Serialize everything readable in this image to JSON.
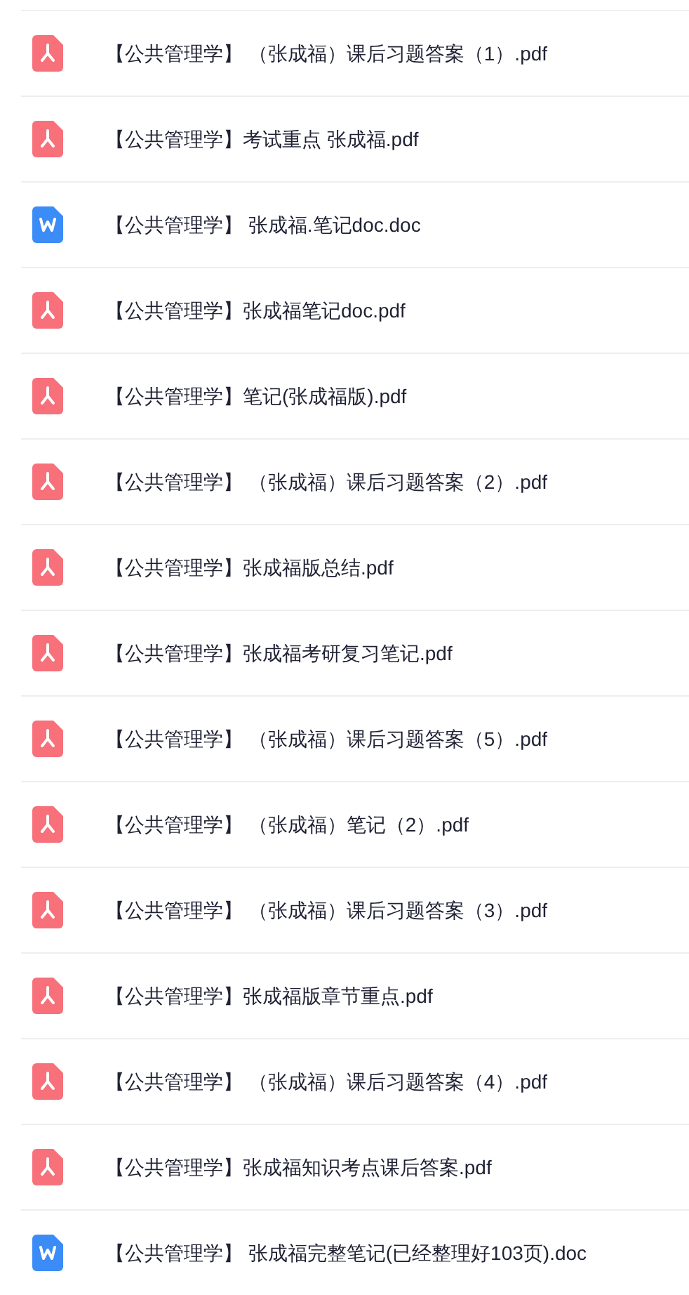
{
  "files": [
    {
      "kind": "pdf",
      "name": "【公共管理学】 （张成福）课后习题答案（1）.pdf"
    },
    {
      "kind": "pdf",
      "name": "【公共管理学】考试重点 张成福.pdf"
    },
    {
      "kind": "doc",
      "name": "【公共管理学】 张成福.笔记doc.doc"
    },
    {
      "kind": "pdf",
      "name": "【公共管理学】张成福笔记doc.pdf"
    },
    {
      "kind": "pdf",
      "name": "【公共管理学】笔记(张成福版).pdf"
    },
    {
      "kind": "pdf",
      "name": "【公共管理学】 （张成福）课后习题答案（2）.pdf"
    },
    {
      "kind": "pdf",
      "name": "【公共管理学】张成福版总结.pdf"
    },
    {
      "kind": "pdf",
      "name": "【公共管理学】张成福考研复习笔记.pdf"
    },
    {
      "kind": "pdf",
      "name": "【公共管理学】 （张成福）课后习题答案（5）.pdf"
    },
    {
      "kind": "pdf",
      "name": "【公共管理学】 （张成福）笔记（2）.pdf"
    },
    {
      "kind": "pdf",
      "name": "【公共管理学】 （张成福）课后习题答案（3）.pdf"
    },
    {
      "kind": "pdf",
      "name": "【公共管理学】张成福版章节重点.pdf"
    },
    {
      "kind": "pdf",
      "name": "【公共管理学】 （张成福）课后习题答案（4）.pdf"
    },
    {
      "kind": "pdf",
      "name": "【公共管理学】张成福知识考点课后答案.pdf"
    },
    {
      "kind": "doc",
      "name": "【公共管理学】 张成福完整笔记(已经整理好103页).doc"
    }
  ]
}
